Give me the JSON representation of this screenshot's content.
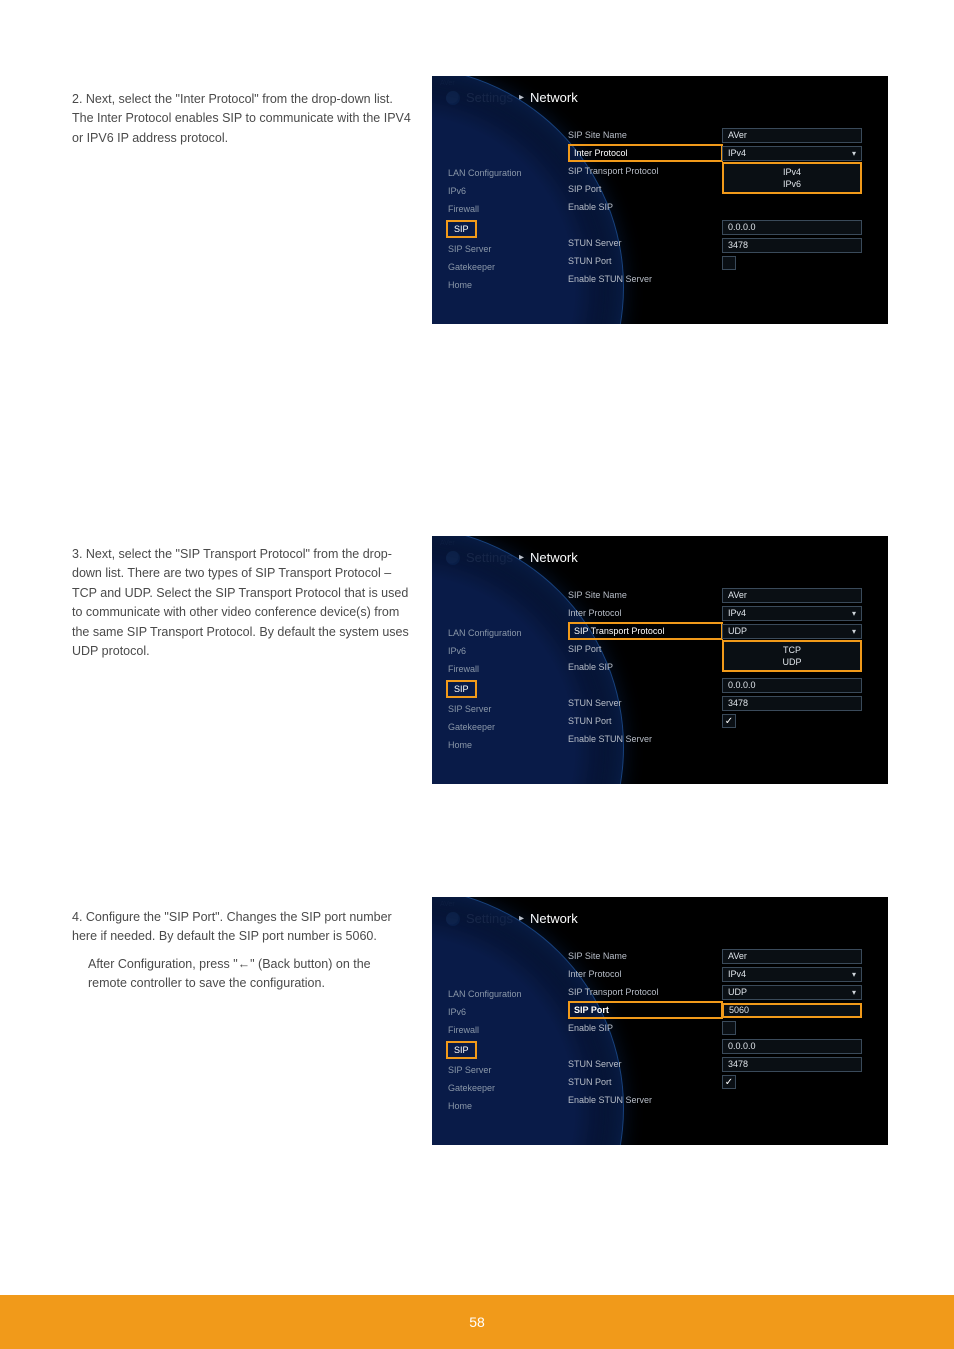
{
  "page_number": "58",
  "steps": {
    "s2": "Next, select the \"Inter Protocol\" from the drop-down list. The Inter Protocol enables SIP to communicate with the IPV4 or IPV6 IP address protocol.",
    "s3": "Next, select the \"SIP Transport Protocol\" from the drop-down list. There are two types of SIP Transport Protocol – TCP and UDP. Select the SIP Transport Protocol that is used to communicate with other video conference device(s) from the same SIP Transport Protocol. By default the system uses UDP protocol.",
    "s4": "Configure the \"SIP Port\". Changes the SIP port number here if needed. By default the SIP port number is 5060.",
    "s4b": "After Configuration, press \"←\" (Back button) on the remote controller to save the configuration."
  },
  "breadcrumb": {
    "part1": "Settings",
    "part2": "Network"
  },
  "brand": "AVer",
  "sidebar": {
    "items": [
      "LAN Configuration",
      "IPv6",
      "Firewall",
      "SIP",
      "SIP Server",
      "Gatekeeper",
      "Home"
    ],
    "active": "SIP"
  },
  "shot1": {
    "labels": [
      "SIP Site Name",
      "Inter Protocol",
      "SIP Transport Protocol",
      "SIP Port",
      "Enable SIP",
      "",
      "STUN Server",
      "STUN Port",
      "Enable STUN Server"
    ],
    "values": {
      "sip_site_name": "AVer",
      "inter_protocol": "IPv4",
      "inter_options": [
        "IPv4",
        "IPv6"
      ],
      "stun_server": "0.0.0.0",
      "stun_port": "3478"
    },
    "highlight_label": "Inter Protocol"
  },
  "shot2": {
    "labels": [
      "SIP Site Name",
      "Inter Protocol",
      "SIP Transport Protocol",
      "SIP Port",
      "Enable SIP",
      "",
      "STUN Server",
      "STUN Port",
      "Enable STUN Server"
    ],
    "values": {
      "sip_site_name": "AVer",
      "inter_protocol": "IPv4",
      "sip_transport": "UDP",
      "transport_options": [
        "TCP",
        "UDP"
      ],
      "stun_server": "0.0.0.0",
      "stun_port": "3478",
      "enable_stun": true
    },
    "highlight_label": "SIP Transport Protocol"
  },
  "shot3": {
    "labels": [
      "SIP Site Name",
      "Inter Protocol",
      "SIP Transport Protocol",
      "SIP Port",
      "Enable SIP",
      "",
      "STUN Server",
      "STUN Port",
      "Enable STUN Server"
    ],
    "values": {
      "sip_site_name": "AVer",
      "inter_protocol": "IPv4",
      "sip_transport": "UDP",
      "sip_port": "5060",
      "stun_server": "0.0.0.0",
      "stun_port": "3478",
      "enable_stun": true
    },
    "highlight_label": "SIP Port"
  }
}
